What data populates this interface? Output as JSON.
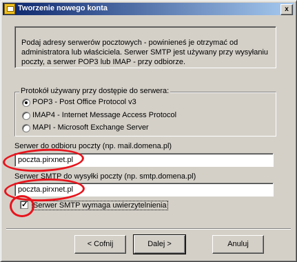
{
  "window": {
    "title": "Tworzenie nowego konta",
    "close_glyph": "x"
  },
  "intro": {
    "text": "Podaj adresy serwerów pocztowych - powinieneś je otrzymać od administratora lub właściciela. Serwer SMTP jest używany przy wysyłaniu poczty, a serwer POP3 lub IMAP - przy odbiorze."
  },
  "protocol": {
    "group_label": "Protokół używany przy dostępie do serwera:",
    "options": [
      {
        "label": "POP3  -  Post Office Protocol v3",
        "selected": true
      },
      {
        "label": "IMAP4 - Internet Message Access Protocol",
        "selected": false
      },
      {
        "label": "MAPI - Microsoft Exchange Server",
        "selected": false
      }
    ]
  },
  "incoming": {
    "label": "Serwer do odbioru poczty (np. mail.domena.pl)",
    "value": "poczta.pirxnet.pl"
  },
  "outgoing": {
    "label": "Serwer SMTP do wysyłki poczty (np. smtp.domena.pl)",
    "value": "poczta.pirxnet.pl"
  },
  "smtp_auth": {
    "label": "Serwer SMTP wymaga uwierzytelnienia",
    "checked": true
  },
  "buttons": {
    "back": "< Cofnij",
    "next": "Dalej >",
    "cancel": "Anuluj"
  },
  "annotation_color": "#e8141c"
}
